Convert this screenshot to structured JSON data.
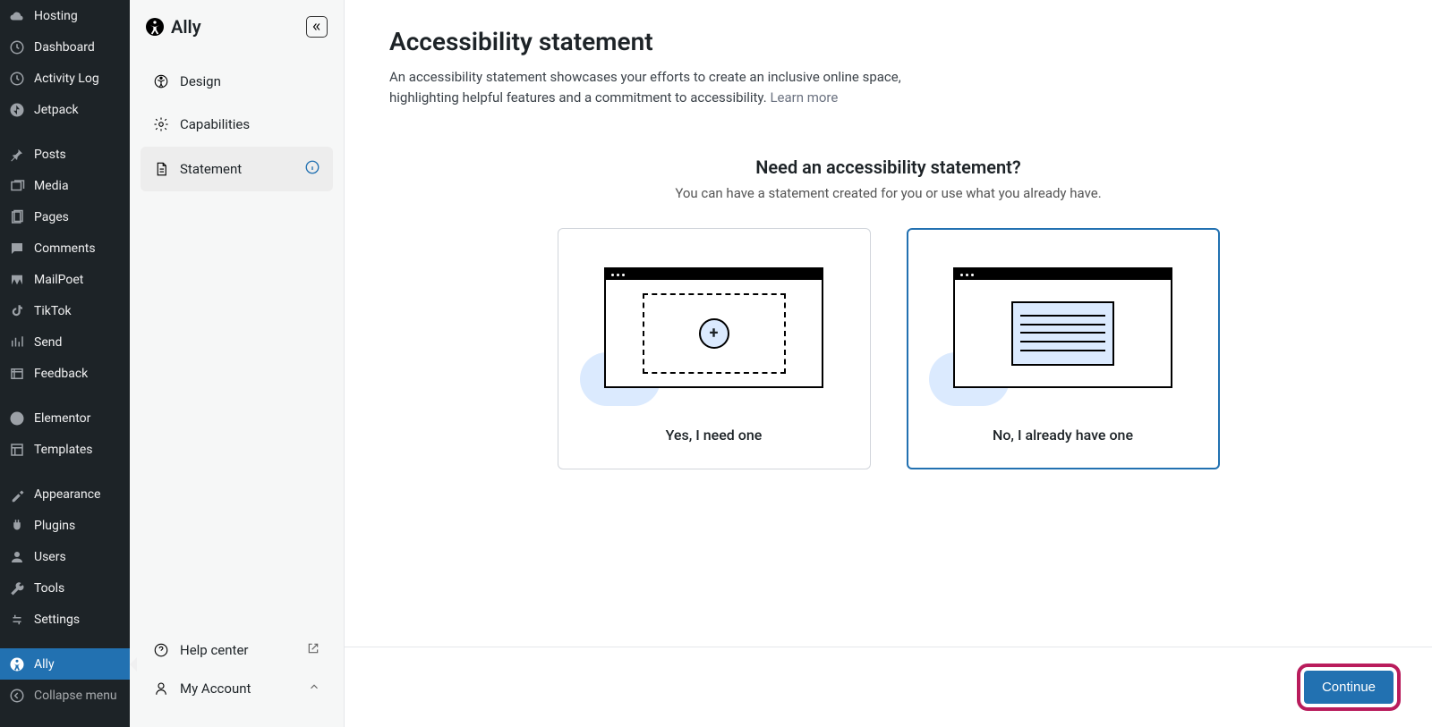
{
  "wp_sidebar": {
    "items": [
      {
        "label": "Hosting",
        "icon": "cloud"
      },
      {
        "label": "Dashboard",
        "icon": "dashboard"
      },
      {
        "label": "Activity Log",
        "icon": "clock"
      },
      {
        "label": "Jetpack",
        "icon": "jetpack"
      }
    ],
    "items2": [
      {
        "label": "Posts",
        "icon": "pin"
      },
      {
        "label": "Media",
        "icon": "media"
      },
      {
        "label": "Pages",
        "icon": "pages"
      },
      {
        "label": "Comments",
        "icon": "comments"
      },
      {
        "label": "MailPoet",
        "icon": "mailpoet"
      },
      {
        "label": "TikTok",
        "icon": "tiktok"
      },
      {
        "label": "Send",
        "icon": "send"
      },
      {
        "label": "Feedback",
        "icon": "feedback"
      }
    ],
    "items3": [
      {
        "label": "Elementor",
        "icon": "elementor"
      },
      {
        "label": "Templates",
        "icon": "templates"
      }
    ],
    "items4": [
      {
        "label": "Appearance",
        "icon": "appearance"
      },
      {
        "label": "Plugins",
        "icon": "plugins"
      },
      {
        "label": "Users",
        "icon": "users"
      },
      {
        "label": "Tools",
        "icon": "tools"
      },
      {
        "label": "Settings",
        "icon": "settings"
      }
    ],
    "active": {
      "label": "Ally",
      "icon": "ally"
    },
    "collapse": {
      "label": "Collapse menu",
      "icon": "collapse"
    }
  },
  "ally_panel": {
    "title": "Ally",
    "nav": [
      {
        "label": "Design"
      },
      {
        "label": "Capabilities"
      },
      {
        "label": "Statement",
        "active": true
      }
    ],
    "footer": {
      "help": "Help center",
      "account": "My Account"
    }
  },
  "main": {
    "title": "Accessibility statement",
    "desc": "An accessibility statement showcases your efforts to create an inclusive online space, highlighting helpful features and a commitment to accessibility.",
    "learn_more": "Learn more",
    "prompt_title": "Need an accessibility statement?",
    "prompt_sub": "You can have a statement created for you or use what you already have.",
    "option_yes": "Yes, I need one",
    "option_no": "No, I already have one",
    "continue": "Continue"
  }
}
